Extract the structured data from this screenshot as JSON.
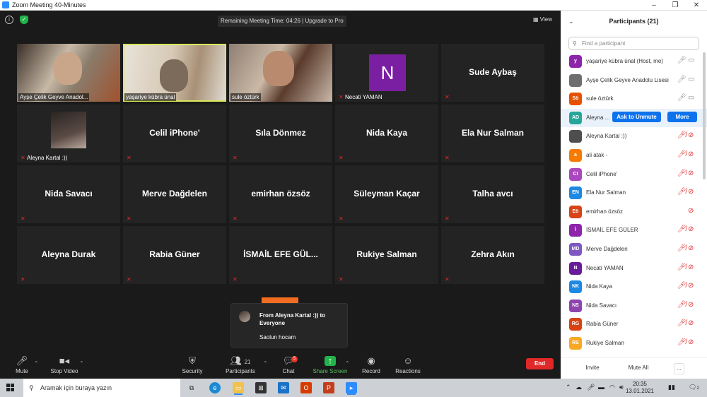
{
  "window": {
    "title": "Zoom Meeting 40-Minutes",
    "controls": [
      "–",
      "❐",
      "✕"
    ]
  },
  "meeting": {
    "remaining": "Remaining Meeting Time: 04:26 | Upgrade to Pro",
    "view_label": "View"
  },
  "tiles": [
    {
      "label": "Ayşe Çelik Geyve Anadol..."
    },
    {
      "label": "yaşariye kübra ünal"
    },
    {
      "label": "sule öztürk"
    },
    {
      "label": "Necati YAMAN",
      "avatar": "N"
    },
    {
      "name": "Sude Aybaş"
    },
    {
      "label": "Aleyna Kartal :))"
    },
    {
      "name": "Celil iPhone'"
    },
    {
      "name": "Sıla Dönmez"
    },
    {
      "name": "Nida Kaya"
    },
    {
      "name": "Ela Nur Salman"
    },
    {
      "name": "Nida Savacı"
    },
    {
      "name": "Merve Dağdelen"
    },
    {
      "name": "emirhan özsöz"
    },
    {
      "name": "Süleyman Kaçar"
    },
    {
      "name": "Talha avcı"
    },
    {
      "name": "Aleyna Durak"
    },
    {
      "name": "Rabia Güner"
    },
    {
      "name": "İSMAİL EFE GÜL..."
    },
    {
      "name": "Rukiye Salman"
    },
    {
      "name": "Zehra Akın"
    }
  ],
  "chat_popup": {
    "from": "From Aleyna Kartal :)) to Everyone",
    "message": "Saolun hocam"
  },
  "toolbar": {
    "mute": "Mute",
    "stop_video": "Stop Video",
    "security": "Security",
    "participants": "Participants",
    "participants_count": "21",
    "chat": "Chat",
    "chat_badge": "5",
    "share_screen": "Share Screen",
    "record": "Record",
    "reactions": "Reactions",
    "end": "End"
  },
  "panel": {
    "title": "Participants (21)",
    "search_placeholder": "Find a participant",
    "ask_to_unmute": "Ask to Unmute",
    "more": "More",
    "participants": [
      {
        "initials": "y",
        "name": "yaşariye kübra ünal (Host, me)",
        "color": "#8e24aa",
        "mic": "on",
        "cam": "on"
      },
      {
        "initials": "",
        "name": "Ayşe Çelik Geyve Anadolu Lisesi",
        "color": "#6e6e6e",
        "mic": "on",
        "cam": "on"
      },
      {
        "initials": "Sö",
        "name": "sule öztürk",
        "color": "#e65100",
        "mic": "on",
        "cam": "on"
      },
      {
        "initials": "AD",
        "name": "Aleyna ...",
        "color": "#26a69a",
        "mic": "",
        "cam": ""
      },
      {
        "initials": "",
        "name": "Aleyna Kartal :))",
        "color": "#4e4e4e",
        "mic": "off",
        "cam": "off"
      },
      {
        "initials": "a",
        "name": "ali atak -",
        "color": "#f57c00",
        "mic": "off",
        "cam": "off"
      },
      {
        "initials": "CI",
        "name": "Celil iPhone'",
        "color": "#ab47bc",
        "mic": "off",
        "cam": "off"
      },
      {
        "initials": "EN",
        "name": "Ela Nur Salman",
        "color": "#1e88e5",
        "mic": "off",
        "cam": "off"
      },
      {
        "initials": "Eö",
        "name": "emirhan özsöz",
        "color": "#d84315",
        "mic": "",
        "cam": "off"
      },
      {
        "initials": "İ",
        "name": "İSMAİL EFE GÜLER",
        "color": "#8e24aa",
        "mic": "off",
        "cam": "off"
      },
      {
        "initials": "MD",
        "name": "Merve Dağdelen",
        "color": "#7e57c2",
        "mic": "off",
        "cam": "off"
      },
      {
        "initials": "N",
        "name": "Necati YAMAN",
        "color": "#6a1b9a",
        "mic": "off",
        "cam": "off"
      },
      {
        "initials": "NK",
        "name": "Nida Kaya",
        "color": "#1e88e5",
        "mic": "off",
        "cam": "off"
      },
      {
        "initials": "NS",
        "name": "Nida Savacı",
        "color": "#8e44ad",
        "mic": "off",
        "cam": "off"
      },
      {
        "initials": "RG",
        "name": "Rabia Güner",
        "color": "#d84315",
        "mic": "off",
        "cam": "off"
      },
      {
        "initials": "RS",
        "name": "Rukiye Salman",
        "color": "#f9a825",
        "mic": "off",
        "cam": "off"
      }
    ],
    "footer": {
      "invite": "Invite",
      "mute_all": "Mute All",
      "more": "..."
    }
  },
  "taskbar": {
    "search_placeholder": "Aramak için buraya yazın",
    "time": "20:35",
    "date": "13.01.2021",
    "notification_count": "2"
  }
}
